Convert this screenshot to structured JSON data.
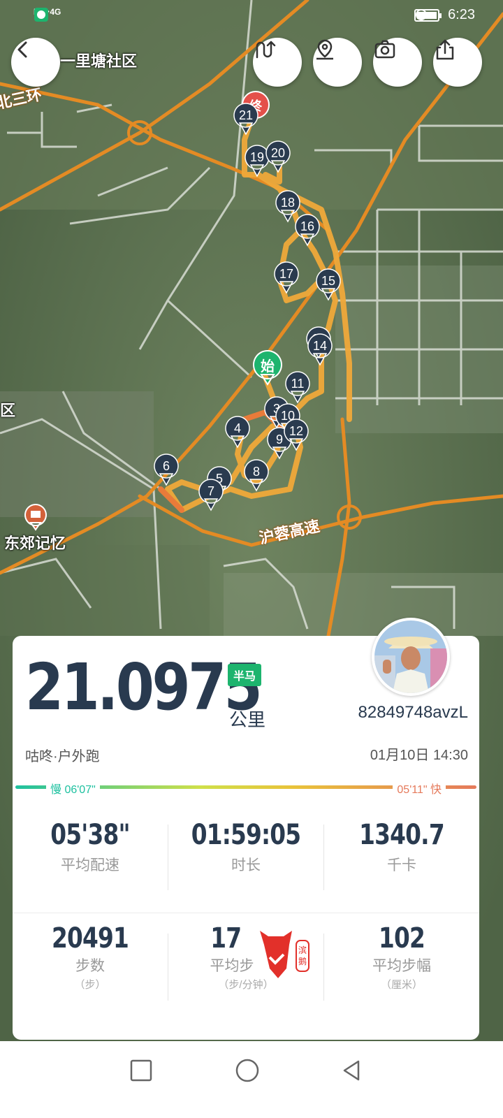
{
  "status_bar": {
    "hd": "HD",
    "network": "4G",
    "time": "6:23"
  },
  "map": {
    "labels": {
      "community": "一里塘社区",
      "ring_road": "北三环",
      "district_edge": "区",
      "poi": "东郊记忆",
      "highway": "沪蓉高速"
    },
    "start_label": "始",
    "end_label": "终",
    "km_markers": [
      "3",
      "4",
      "5",
      "6",
      "7",
      "8",
      "9",
      "10",
      "11",
      "12",
      "13",
      "14",
      "15",
      "16",
      "17",
      "18",
      "19",
      "20",
      "21"
    ]
  },
  "top_controls": {
    "back": "back-icon",
    "route": "route-icon",
    "location": "location-pin-icon",
    "camera": "camera-icon",
    "share": "share-icon"
  },
  "summary": {
    "distance": "21.0975",
    "badge": "半马",
    "unit": "公里",
    "username": "82849748avzL",
    "source": "咕咚·户外跑",
    "datetime": "01月10日 14:30",
    "pace_slow": "慢 06'07\"",
    "pace_fast": "05'11\" 快"
  },
  "metrics": [
    {
      "value": "05'38\"",
      "label": "平均配速",
      "sub": ""
    },
    {
      "value": "01:59:05",
      "label": "时长",
      "sub": ""
    },
    {
      "value": "1340.7",
      "label": "千卡",
      "sub": ""
    },
    {
      "value": "20491",
      "label": "步数",
      "sub": "（步）"
    },
    {
      "value": "17",
      "label": "平均步",
      "sub": "（步/分钟）"
    },
    {
      "value": "102",
      "label": "平均步幅",
      "sub": "（厘米）"
    }
  ],
  "colors": {
    "accent_green": "#1db46e",
    "text_dark": "#293a4f",
    "route": "#f0a93a",
    "marker": "#2a3b4f",
    "fast": "#e57a5b",
    "slow": "#1ec1a0"
  }
}
